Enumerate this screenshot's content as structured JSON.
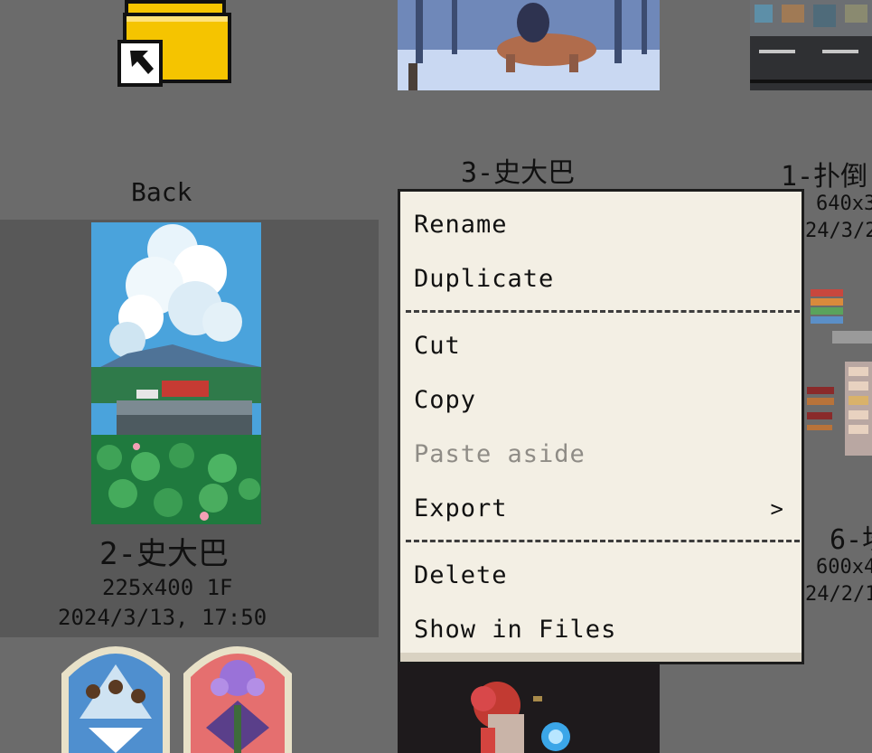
{
  "back_tile": {
    "label": "Back",
    "icon": "folder-back-icon"
  },
  "tile_top_center": {
    "name": "3-史大巴"
  },
  "tile_top_right": {
    "name": "1-扑倒",
    "size": "640x3",
    "date": "24/3/2"
  },
  "tile_selected": {
    "name": "2-史大巴",
    "size": "225x400 1F",
    "date": "2024/3/13, 17:50"
  },
  "tile_mid_right": {
    "name": "6-坎",
    "size": "600x4",
    "date": "24/2/1"
  },
  "context_menu": {
    "items": {
      "rename": "Rename",
      "duplicate": "Duplicate",
      "cut": "Cut",
      "copy": "Copy",
      "paste_aside": "Paste aside",
      "export": "Export",
      "export_arrow": ">",
      "delete": "Delete",
      "show_in_files": "Show in Files"
    }
  },
  "colors": {
    "background": "#6b6b6b",
    "selected_tile": "#585858",
    "menu_bg": "#f3efe4",
    "menu_disabled_text": "#8f8c86",
    "folder_yellow": "#f5c400"
  }
}
